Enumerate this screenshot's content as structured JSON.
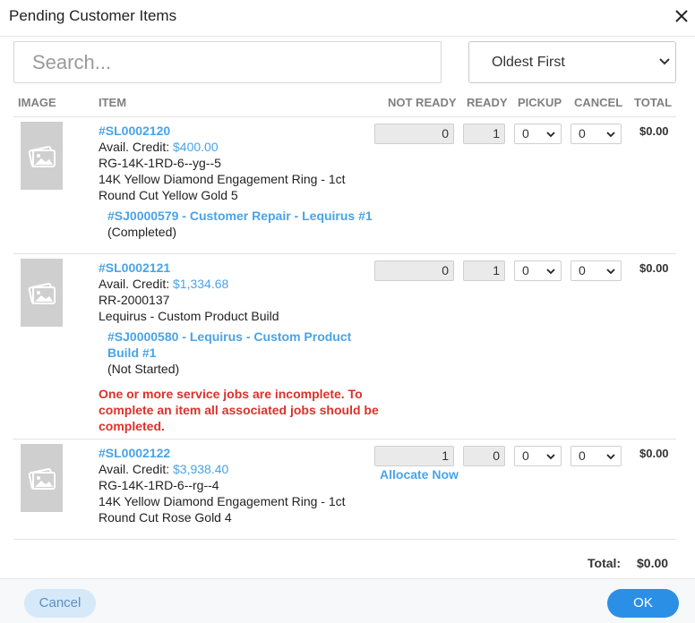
{
  "dialog": {
    "title": "Pending Customer Items"
  },
  "search": {
    "placeholder": "Search..."
  },
  "sort": {
    "selected": "Oldest First"
  },
  "columns": {
    "image": "IMAGE",
    "item": "ITEM",
    "not_ready": "NOT READY",
    "ready": "READY",
    "pickup": "PICKUP",
    "cancel": "CANCEL",
    "total": "TOTAL"
  },
  "items": [
    {
      "sku": "#SL0002120",
      "credit_label": "Avail. Credit:",
      "credit": "$400.00",
      "code": "RG-14K-1RD-6--yg--5",
      "desc_line1": "14K Yellow Diamond Engagement Ring - 1ct",
      "desc_line2": "Round Cut Yellow Gold 5",
      "job_line1": "#SJ0000579 - Customer Repair - Lequirus #1",
      "job_status": "(Completed)",
      "not_ready": "0",
      "ready": "1",
      "pickup": "0",
      "cancel": "0",
      "total": "$0.00"
    },
    {
      "sku": "#SL0002121",
      "credit_label": "Avail. Credit:",
      "credit": "$1,334.68",
      "code": "RR-2000137",
      "desc_line1": "Lequirus - Custom Product Build",
      "job_line1": "#SJ0000580 - Lequirus - Custom Product",
      "job_line2": "Build #1",
      "job_status": "(Not Started)",
      "error_line1": "One or more service jobs are incomplete. To",
      "error_line2": "complete an item all associated jobs should be",
      "error_line3": "completed.",
      "not_ready": "0",
      "ready": "1",
      "pickup": "0",
      "cancel": "0",
      "total": "$0.00"
    },
    {
      "sku": "#SL0002122",
      "credit_label": "Avail. Credit:",
      "credit": "$3,938.40",
      "code": "RG-14K-1RD-6--rg--4",
      "desc_line1": "14K Yellow Diamond Engagement Ring - 1ct",
      "desc_line2": "Round Cut Rose Gold 4",
      "not_ready": "1",
      "ready": "0",
      "pickup": "0",
      "cancel": "0",
      "total": "$0.00",
      "allocate_label": "Allocate Now"
    }
  ],
  "summary": {
    "total_label": "Total:",
    "total_value": "$0.00"
  },
  "footer": {
    "cancel_label": "Cancel",
    "ok_label": "OK"
  },
  "colors": {
    "accent": "#2c8fe6",
    "link": "#4aa3e8",
    "error": "#d9332b"
  },
  "icons": {
    "close": "close-icon",
    "chevron": "chevron-down-icon",
    "image_placeholder": "image-placeholder-icon"
  }
}
